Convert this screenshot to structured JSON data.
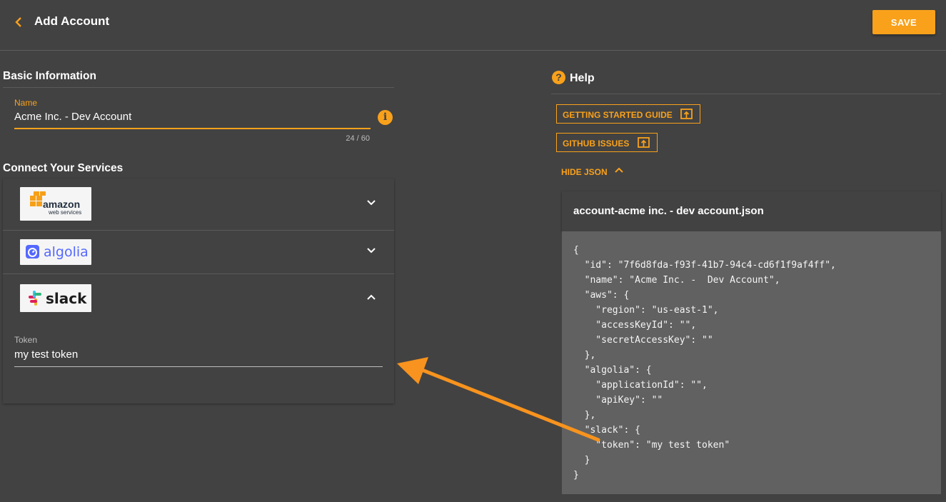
{
  "header": {
    "title": "Add Account",
    "save_label": "SAVE"
  },
  "basic_info": {
    "section_title": "Basic Information",
    "name_label": "Name",
    "name_value": "Acme Inc. -  Dev Account",
    "counter": "24 / 60"
  },
  "services": {
    "section_title": "Connect Your Services",
    "items": [
      {
        "name": "amazon web services",
        "logo_text": "amazon",
        "logo_subtext": "web services",
        "expanded": false
      },
      {
        "name": "algolia",
        "logo_text": "algolia",
        "expanded": false
      },
      {
        "name": "slack",
        "logo_text": "slack",
        "expanded": true
      }
    ],
    "token_label": "Token",
    "token_value": "my test token"
  },
  "help": {
    "title": "Help",
    "guide_label": "GETTING STARTED GUIDE",
    "issues_label": "GITHUB ISSUES",
    "toggle_json_label": "HIDE JSON",
    "json_filename": "account-acme inc. - dev account.json",
    "json_text": "{\n  \"id\": \"7f6d8fda-f93f-41b7-94c4-cd6f1f9af4ff\",\n  \"name\": \"Acme Inc. -  Dev Account\",\n  \"aws\": {\n    \"region\": \"us-east-1\",\n    \"accessKeyId\": \"\",\n    \"secretAccessKey\": \"\"\n  },\n  \"algolia\": {\n    \"applicationId\": \"\",\n    \"apiKey\": \"\"\n  },\n  \"slack\": {\n    \"token\": \"my test token\"\n  }\n}"
  },
  "colors": {
    "accent": "#f9a11b",
    "background": "#424242",
    "code_bg": "#616161"
  }
}
